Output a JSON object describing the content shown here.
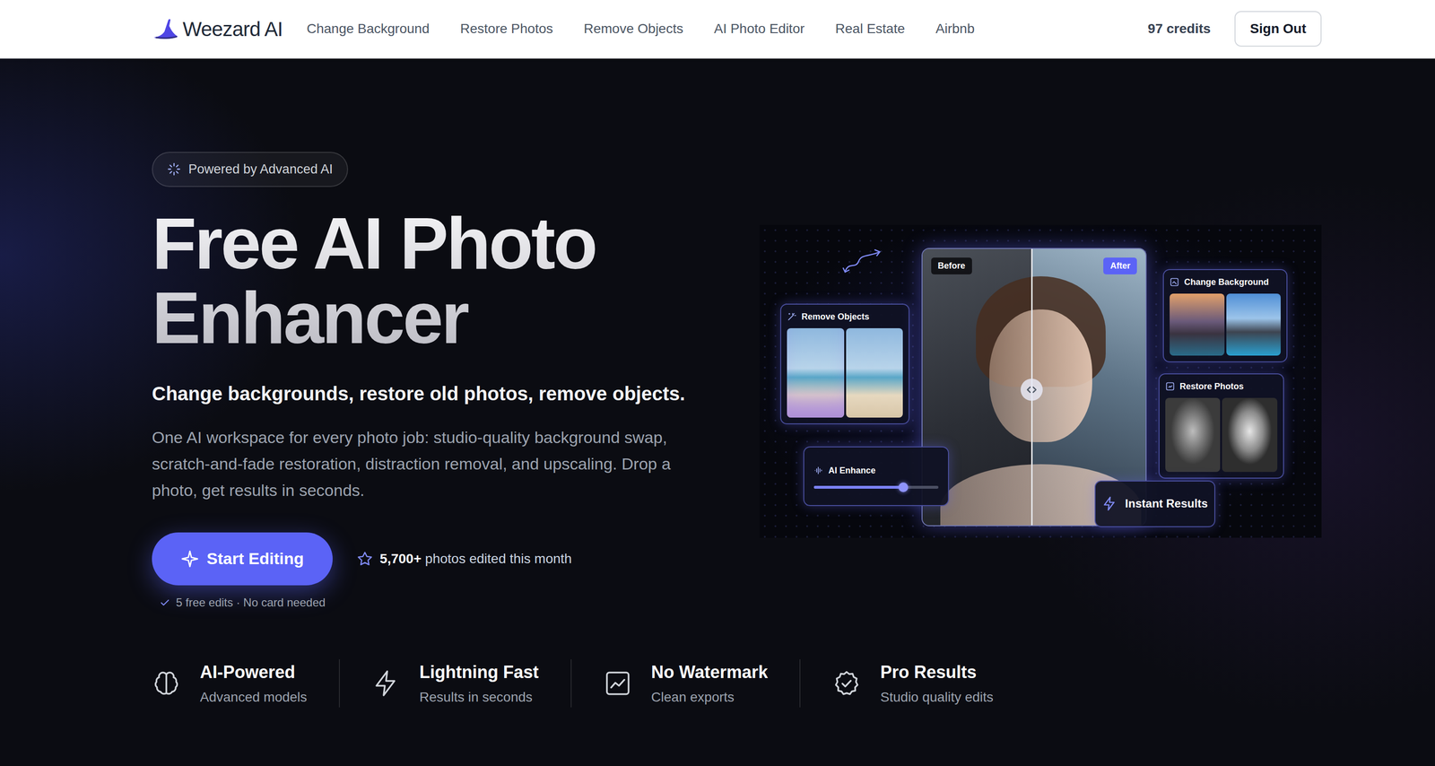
{
  "brand": {
    "name": "Weezard AI"
  },
  "nav": {
    "links": [
      "Change Background",
      "Restore Photos",
      "Remove Objects",
      "AI Photo Editor",
      "Real Estate",
      "Airbnb"
    ],
    "credits": "97 credits",
    "sign_out": "Sign Out"
  },
  "hero": {
    "badge": "Powered by Advanced AI",
    "title_lines": [
      "Free AI Photo",
      "Enhancer"
    ],
    "subtitle": "Change backgrounds, restore old photos, remove objects.",
    "description": "One AI workspace for every photo job: studio-quality background swap, scratch-and-fade restoration, distraction removal, and upscaling. Drop a photo, get results in seconds.",
    "cta": "Start Editing",
    "stat_value": "5,700+",
    "stat_label": "photos edited this month",
    "note": "5 free edits · No card needed"
  },
  "showcase": {
    "remove_objects": "Remove Objects",
    "before": "Before",
    "after": "After",
    "compare_level": 0.49,
    "change_background": "Change Background",
    "restore_photos": "Restore Photos",
    "ai_enhance": {
      "label": "AI Enhance",
      "level": 0.72
    },
    "instant_results": "Instant Results"
  },
  "features": [
    {
      "title": "AI-Powered",
      "subtitle": "Advanced models"
    },
    {
      "title": "Lightning Fast",
      "subtitle": "Results in seconds"
    },
    {
      "title": "No Watermark",
      "subtitle": "Clean exports"
    },
    {
      "title": "Pro Results",
      "subtitle": "Studio quality edits"
    }
  ]
}
